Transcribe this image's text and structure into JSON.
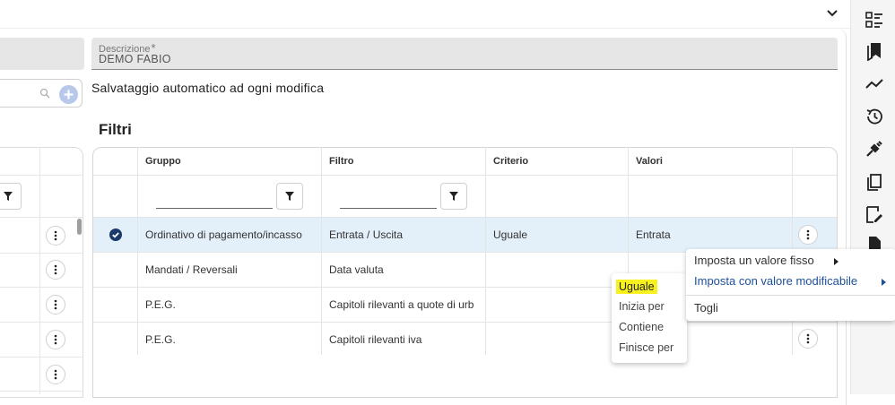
{
  "header": {
    "collapse_icon": "chevron-down-icon"
  },
  "right_rail": {
    "icons": [
      "list-checks-icon",
      "bookmark-icon",
      "trend-line-icon",
      "history-icon",
      "plug-icon",
      "clipboard-icon",
      "edit-document-icon",
      "document-icon"
    ]
  },
  "left_panel": {
    "search_icon": "search-icon",
    "add_icon": "plus-icon",
    "filter_icon": "filter-icon",
    "row_action_icon": "more-vertical-icon"
  },
  "form": {
    "description_label": "Descrizione",
    "description_required_mark": "*",
    "description_value": "DEMO FABIO",
    "autosave_text": "Salvataggio automatico ad ogni modifica"
  },
  "filters": {
    "title": "Filtri",
    "columns": [
      "Gruppo",
      "Filtro",
      "Criterio",
      "Valori"
    ],
    "rows": [
      {
        "selected": true,
        "gruppo": "Ordinativo di pagamento/incasso",
        "filtro": "Entrata / Uscita",
        "criterio": "Uguale",
        "valori": "Entrata",
        "has_action": true
      },
      {
        "selected": false,
        "gruppo": "Mandati / Reversali",
        "filtro": "Data valuta",
        "criterio": "",
        "valori": "",
        "has_action": false
      },
      {
        "selected": false,
        "gruppo": "P.E.G.",
        "filtro": "Capitoli rilevanti a quote di urb",
        "criterio": "",
        "valori": "",
        "has_action": false
      },
      {
        "selected": false,
        "gruppo": "P.E.G.",
        "filtro": "Capitoli rilevanti iva",
        "criterio": "",
        "valori": "",
        "has_action": true
      }
    ]
  },
  "criterio_menu": {
    "options": [
      "Uguale",
      "Inizia per",
      "Contiene",
      "Finisce per"
    ],
    "highlighted": "Uguale"
  },
  "valori_menu": {
    "items": [
      "Imposta un valore fisso",
      "Imposta con valore modificabile",
      "Togli"
    ],
    "active": "Imposta con valore modificabile"
  },
  "colors": {
    "selected_row": "#e3eff9",
    "accent": "#1e4f9c",
    "highlight": "#f7f21f"
  }
}
